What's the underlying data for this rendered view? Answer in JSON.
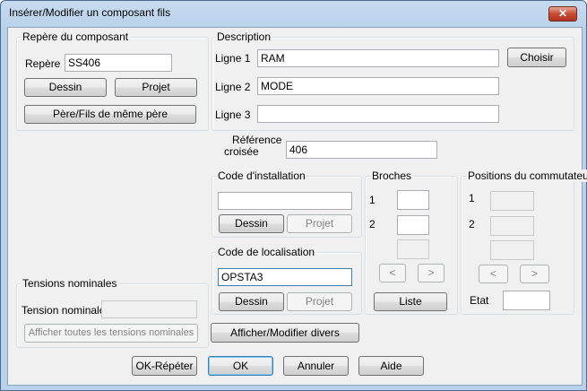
{
  "window": {
    "title": "Insérer/Modifier un composant fils",
    "close_glyph": "✕"
  },
  "repere_group": {
    "label": "Repère du composant",
    "repere_label": "Repère",
    "repere_value": "SS406",
    "dessin": "Dessin",
    "projet": "Projet",
    "pere_fils": "Père/Fils de même père"
  },
  "description": {
    "label": "Description",
    "ligne1_label": "Ligne 1",
    "ligne1_value": "RAM",
    "ligne2_label": "Ligne 2",
    "ligne2_value": "MODE",
    "ligne3_label": "Ligne 3",
    "ligne3_value": "",
    "choisir": "Choisir"
  },
  "reference": {
    "label_line1": "Référence",
    "label_line2": "croisée",
    "value": "406"
  },
  "installation": {
    "label": "Code d'installation",
    "value": "",
    "dessin": "Dessin",
    "projet": "Projet"
  },
  "localisation": {
    "label": "Code de localisation",
    "value": "OPSTA3",
    "dessin": "Dessin",
    "projet": "Projet"
  },
  "broches": {
    "label": "Broches",
    "row1": "1",
    "row2": "2",
    "prev": "<",
    "next": ">",
    "liste": "Liste"
  },
  "positions": {
    "label": "Positions du commutateur",
    "row1": "1",
    "row2": "2",
    "prev": "<",
    "next": ">",
    "etat_label": "Etat",
    "etat_value": ""
  },
  "tensions": {
    "label": "Tensions nominales",
    "tension_label": "Tension nominale",
    "tension_value": "",
    "afficher_toutes": "Afficher toutes les tensions nominales"
  },
  "divers_button": "Afficher/Modifier divers",
  "footer": {
    "ok_repeter": "OK-Répéter",
    "ok": "OK",
    "annuler": "Annuler",
    "aide": "Aide"
  }
}
